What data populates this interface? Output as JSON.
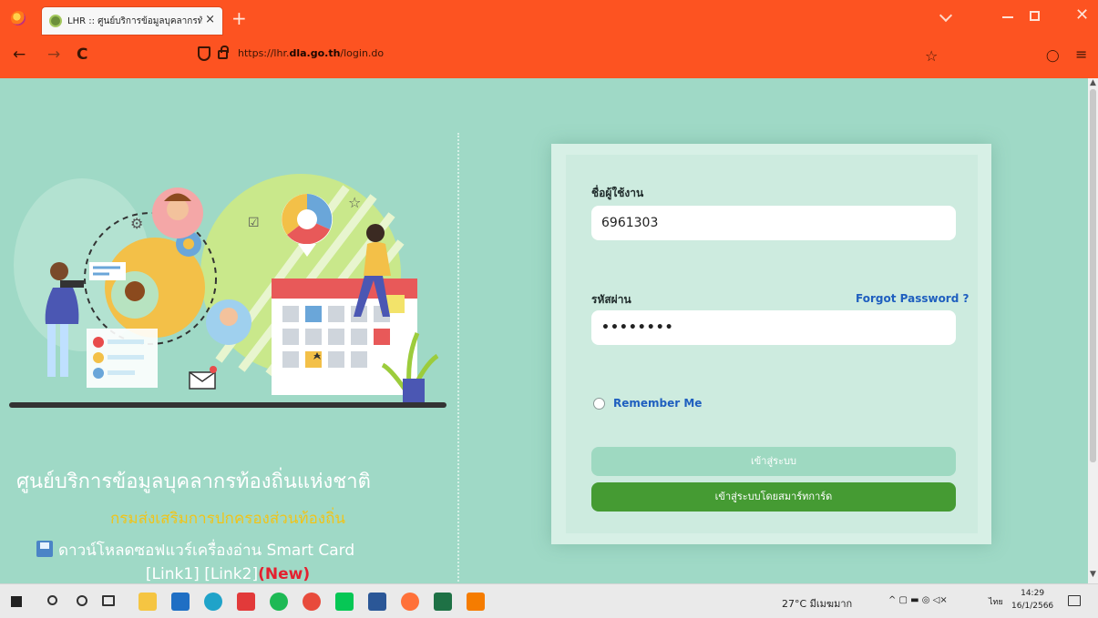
{
  "browser": {
    "tab_title": "LHR :: ศูนย์บริการข้อมูลบุคลากรท้องถิ่น",
    "tab_close": "×",
    "new_tab": "+",
    "url_prefix": "https://lhr.",
    "url_domain": "dla.go.th",
    "url_path": "/login.do",
    "back": "←",
    "forward": "→",
    "reload": "C",
    "star": "☆",
    "pocket": "◯",
    "menu": "≡",
    "close": "✕"
  },
  "left": {
    "title": "ศูนย์บริการข้อมูลบุคลากรท้องถิ่นแห่งชาติ",
    "subtitle": "กรมส่งเสริมการปกครองส่วนท้องถิ่น",
    "download_text": "ดาวน์โหลดซอฟแวร์เครื่องอ่าน Smart Card",
    "link1": "[Link1]",
    "link2": "[Link2]",
    "new_tag": "(New)"
  },
  "login": {
    "username_label": "ชื่อผู้ใช้งาน",
    "username_value": "6961303",
    "password_label": "รหัสผ่าน",
    "password_value": "••••••••",
    "forgot_password": "Forgot Password ?",
    "remember_me": "Remember Me",
    "login_button": "เข้าสู่ระบบ",
    "smartcard_button": "เข้าสู่ระบบโดยสมาร์ทการ์ด"
  },
  "taskbar": {
    "weather": "27°C มีเมฆมาก",
    "lang": "ไทย",
    "time": "14:29",
    "date": "16/1/2566"
  },
  "colors": {
    "browser_chrome": "#fd5321",
    "page_bg": "#9fd9c6",
    "link_blue": "#1f5fbf",
    "smartcard_green": "#459b33",
    "subtitle_yellow": "#f0c419"
  }
}
